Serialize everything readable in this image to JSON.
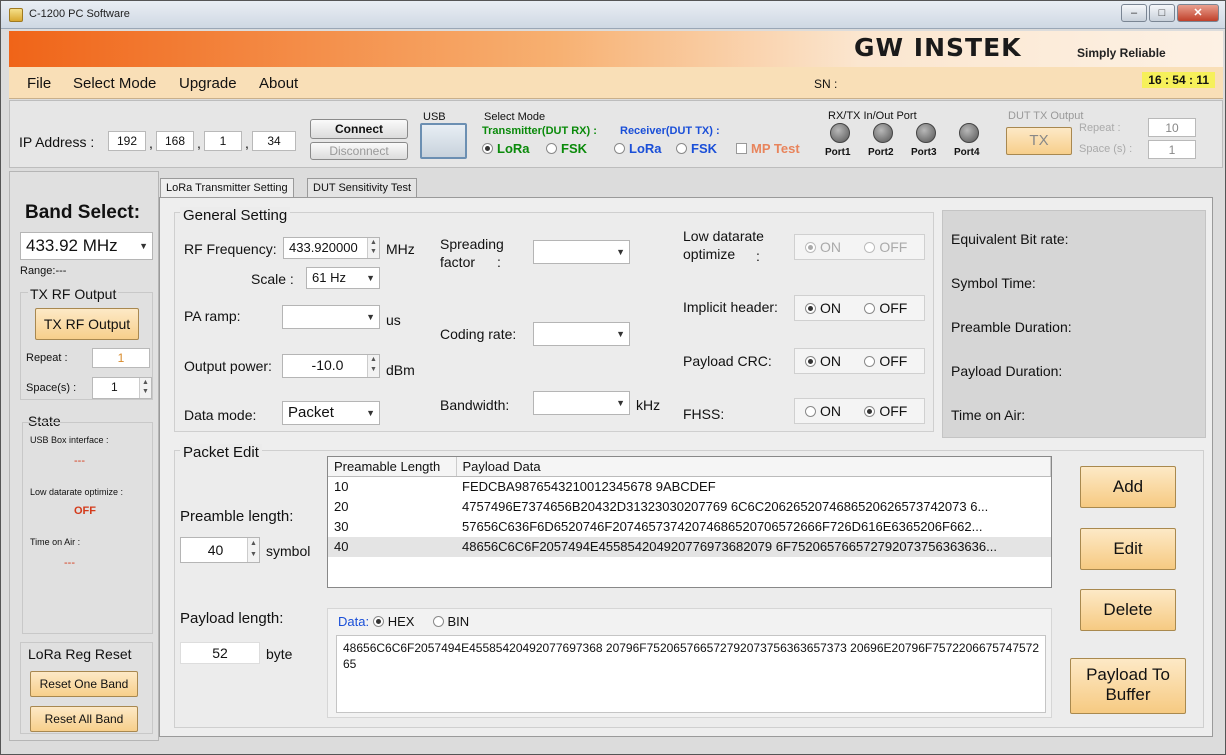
{
  "window": {
    "title": "C-1200 PC Software"
  },
  "banner": {
    "logo": "GW INSTEK",
    "slogan": "Simply  Reliable"
  },
  "menu": {
    "items": [
      "File",
      "Select Mode",
      "Upgrade",
      "About"
    ],
    "sn_label": "SN :",
    "clock": "16 : 54 : 11"
  },
  "connection": {
    "ip_label": "IP Address :",
    "ip": [
      "192",
      "168",
      "1",
      "34"
    ],
    "connect_label": "Connect",
    "disconnect_label": "Disconnect",
    "usb_label": "USB"
  },
  "select_mode": {
    "title": "Select Mode",
    "transmitter_label": "Transmitter(DUT RX) :",
    "receiver_label": "Receiver(DUT TX) :",
    "tx_lora": "LoRa",
    "tx_fsk": "FSK",
    "rx_lora": "LoRa",
    "rx_fsk": "FSK",
    "mp_test": "MP Test"
  },
  "ports": {
    "title": "RX/TX In/Out Port",
    "labels": [
      "Port1",
      "Port2",
      "Port3",
      "Port4"
    ]
  },
  "dut_tx": {
    "title": "DUT TX Output",
    "tx_label": "TX",
    "repeat_label": "Repeat :",
    "repeat": "10",
    "space_label": "Space (s) :",
    "space": "1"
  },
  "left": {
    "band_title": "Band Select:",
    "band_value": "433.92 MHz",
    "range": "Range:---",
    "tx_rf_title": "TX RF Output",
    "tx_rf_button": "TX RF Output",
    "repeat_label": "Repeat :",
    "repeat": "1",
    "space_label": "Space(s) :",
    "space": "1",
    "state_title": "State",
    "usb_label": "USB Box interface :",
    "usb_value": "---",
    "ldro_label": "Low datarate optimize :",
    "ldro_value": "OFF",
    "toa_label": "Time on Air :",
    "toa_value": "---",
    "reg_reset_title": "LoRa Reg Reset",
    "reset_one": "Reset One Band",
    "reset_all": "Reset All Band"
  },
  "tabs": [
    "LoRa Transmitter Setting",
    "DUT Sensitivity Test"
  ],
  "general": {
    "title": "General Setting",
    "rf_freq_label": "RF Frequency:",
    "rf_freq": "433.920000",
    "rf_unit": "MHz",
    "scale_label": "Scale :",
    "scale": "61 Hz",
    "pa_ramp_label": "PA ramp:",
    "pa_unit": "us",
    "output_power_label": "Output power:",
    "output_power": "-10.0",
    "power_unit": "dBm",
    "data_mode_label": "Data mode:",
    "data_mode": "Packet",
    "spreading_label_1": "Spreading",
    "spreading_label_2": "factor",
    "spreading_colon": ":",
    "coding_label": "Coding rate:",
    "bandwidth_label": "Bandwidth:",
    "bw_unit": "kHz",
    "ldro_label_1": "Low datarate",
    "ldro_label_2": "optimize",
    "ldro_colon": ":",
    "implicit_label": "Implicit header:",
    "crc_label": "Payload CRC:",
    "fhss_label": "FHSS:",
    "on": "ON",
    "off": "OFF"
  },
  "info": {
    "bitrate": "Equivalent Bit rate:",
    "symbol_time": "Symbol Time:",
    "preamble_duration": "Preamble Duration:",
    "payload_duration": "Payload Duration:",
    "time_on_air": "Time on Air:"
  },
  "packet": {
    "title": "Packet Edit",
    "preamble_label": "Preamble length:",
    "preamble": "40",
    "preamble_unit": "symbol",
    "payload_label": "Payload length:",
    "payload": "52",
    "payload_unit": "byte",
    "columns": [
      "Preamable Length",
      "Payload Data"
    ],
    "rows": [
      [
        "10",
        "FEDCBA9876543210012345678 9ABCDEF"
      ],
      [
        "20",
        "4757496E7374656B20432D31323030207769 6C6C2062652074686520626573742073 6..."
      ],
      [
        "30",
        "57656C636F6D6520746F20746573742074686520706572666F726D616E6365206F662..."
      ],
      [
        "40",
        "48656C6C6F2057494E455854204920776973682079 6F752065766572792073756363636..."
      ]
    ],
    "data_label": "Data:",
    "hex": "HEX",
    "bin": "BIN",
    "payload_text": "48656C6C6F2057494E45585420492077697368 20796F752065766572792073756363657373 20696E20796F757220667574757265",
    "add": "Add",
    "edit": "Edit",
    "delete": "Delete",
    "buffer_1": "Payload To",
    "buffer_2": "Buffer"
  }
}
